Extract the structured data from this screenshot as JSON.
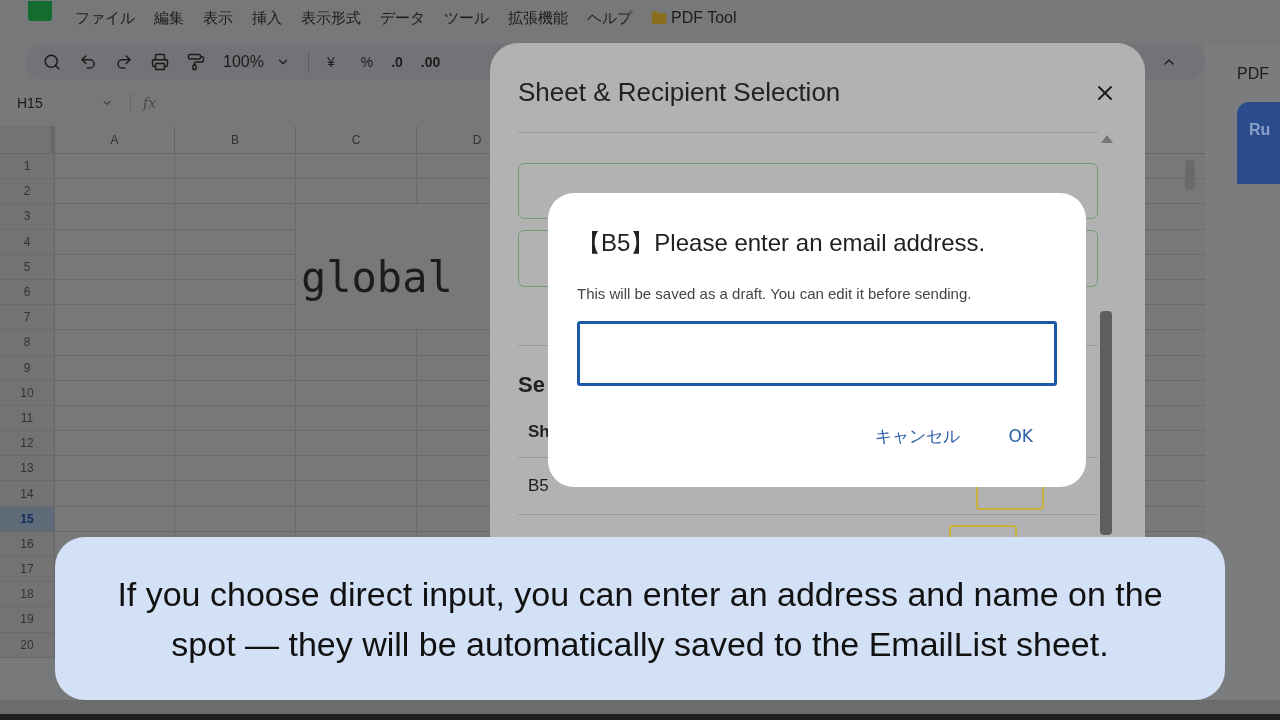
{
  "app": {
    "menu": [
      "ファイル",
      "編集",
      "表示",
      "挿入",
      "表示形式",
      "データ",
      "ツール",
      "拡張機能",
      "ヘルプ"
    ],
    "addon_menu": "PDF Tool",
    "toolbar": {
      "zoom": "100%",
      "currency": "¥",
      "percent": "%",
      "decrease_decimal": ".0",
      "increase_decimal": ".00"
    },
    "name_box": "H15",
    "formula_label": "fx"
  },
  "sheet": {
    "columns": [
      "A",
      "B",
      "C",
      "D"
    ],
    "rows": [
      {
        "label": "1",
        "selected": false
      },
      {
        "label": "2",
        "selected": false
      },
      {
        "label": "3",
        "selected": false
      },
      {
        "label": "4",
        "selected": false
      },
      {
        "label": "5",
        "selected": false
      },
      {
        "label": "6",
        "selected": false
      },
      {
        "label": "7",
        "selected": false
      },
      {
        "label": "8",
        "selected": false
      },
      {
        "label": "9",
        "selected": false
      },
      {
        "label": "10",
        "selected": false
      },
      {
        "label": "11",
        "selected": false
      },
      {
        "label": "12",
        "selected": false
      },
      {
        "label": "13",
        "selected": false
      },
      {
        "label": "14",
        "selected": false
      },
      {
        "label": "15",
        "selected": true
      },
      {
        "label": "16",
        "selected": false
      },
      {
        "label": "17",
        "selected": false
      },
      {
        "label": "18",
        "selected": false
      },
      {
        "label": "19",
        "selected": false
      },
      {
        "label": "20",
        "selected": false
      }
    ],
    "merged_cell": "global"
  },
  "side_panel": {
    "title": "PDF",
    "button": "Ru"
  },
  "dialog": {
    "title": "Sheet & Recipient Selection",
    "section_heading": "Se",
    "table_header": "Sh",
    "rows": [
      {
        "sheet": "B5"
      }
    ]
  },
  "prompt": {
    "title": "【B5】Please enter an email address.",
    "hint": "This will be saved as a draft. You can edit it before sending.",
    "buttons": [
      "キャンセル",
      "OK"
    ]
  },
  "caption": "If you choose direct input, you can enter an address and name on the\nspot ― they will be automatically saved to the EmailList sheet."
}
